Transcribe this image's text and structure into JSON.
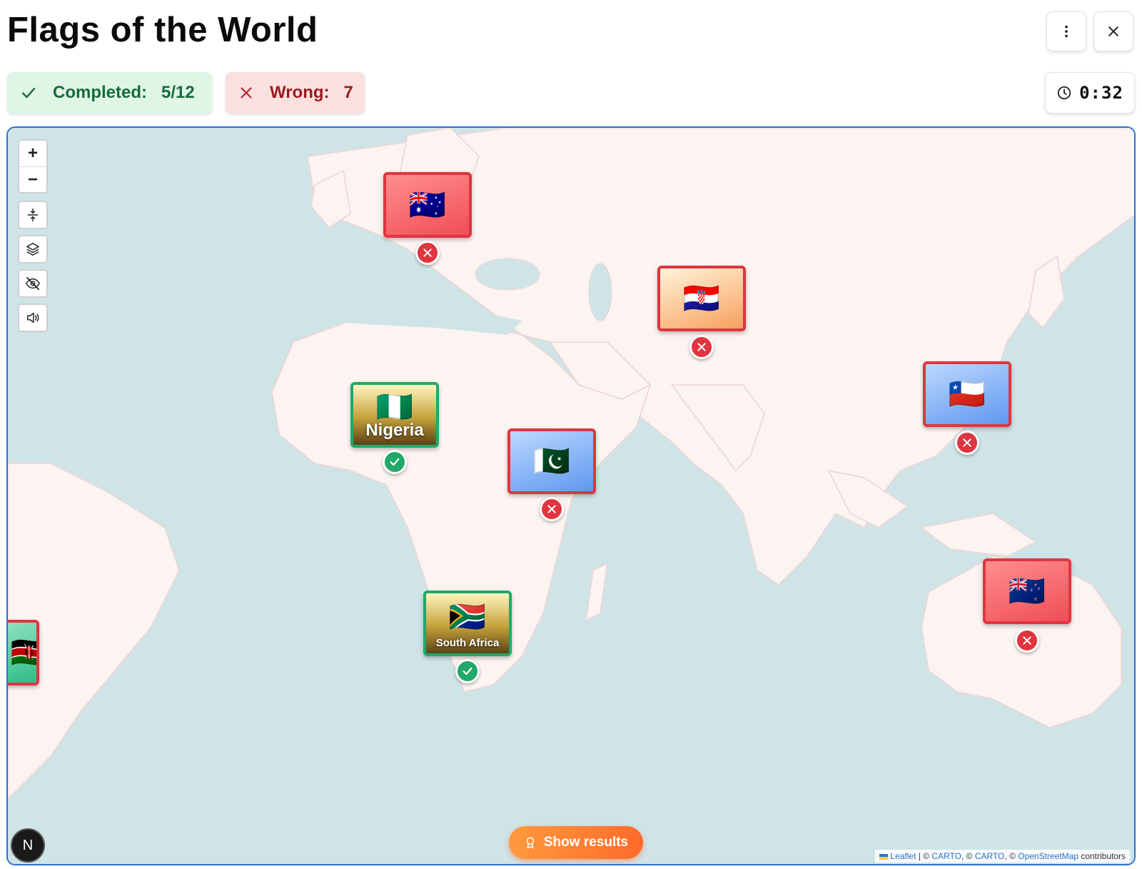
{
  "header": {
    "title": "Flags of the World"
  },
  "stats": {
    "completed_label": "Completed:",
    "completed_value": "5/12",
    "wrong_label": "Wrong:",
    "wrong_value": "7"
  },
  "timer": {
    "value": "0:32"
  },
  "map_controls": {
    "zoom_in": "+",
    "zoom_out": "−"
  },
  "markers": [
    {
      "id": "europe",
      "state": "wrong",
      "flag": "🇦🇺",
      "label": ""
    },
    {
      "id": "south-asia",
      "state": "wrong",
      "flag": "🇭🇷",
      "label": ""
    },
    {
      "id": "east-asia",
      "state": "wrong",
      "flag": "🇨🇱",
      "label": ""
    },
    {
      "id": "west-africa",
      "state": "right",
      "flag": "🇳🇬",
      "label": "Nigeria"
    },
    {
      "id": "east-africa",
      "state": "wrong",
      "flag": "🇵🇰",
      "label": ""
    },
    {
      "id": "southern-africa",
      "state": "right",
      "flag": "🇿🇦",
      "label": "South Africa"
    },
    {
      "id": "australia",
      "state": "wrong",
      "flag": "🇳🇿",
      "label": ""
    },
    {
      "id": "south-america-edge",
      "state": "wrong",
      "flag": "🇰🇪",
      "label": ""
    }
  ],
  "show_results_label": "Show results",
  "avatar_letter": "N",
  "attribution": {
    "leaflet": "Leaflet",
    "sep1": " | © ",
    "carto1": "CARTO",
    "sep2": ", © ",
    "carto2": "CARTO",
    "sep3": ", © ",
    "osm": "OpenStreetMap",
    "suffix": " contributors"
  },
  "colors": {
    "wrong": "#e0353f",
    "right": "#22a86b",
    "accent": "#ff7a33",
    "water": "#cfe4e7",
    "land": "#fbf4f1"
  }
}
